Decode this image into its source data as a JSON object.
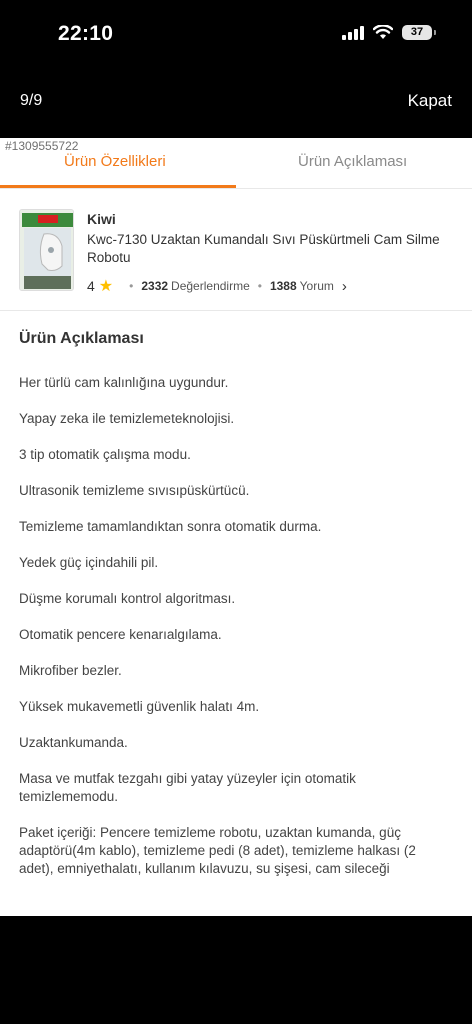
{
  "status_bar": {
    "time": "22:10",
    "battery": "37"
  },
  "viewer": {
    "page_counter": "9/9",
    "close_label": "Kapat"
  },
  "watermark_id": "#1309555722",
  "tabs": [
    {
      "label": "Ürün Özellikleri",
      "active": true
    },
    {
      "label": "Ürün Açıklaması",
      "active": false
    }
  ],
  "product": {
    "brand": "Kiwi",
    "name": "Kwc-7130 Uzaktan Kumandalı Sıvı Püskürtmeli Cam Silme Robotu",
    "rating": "4",
    "rating_count": "2332",
    "rating_label": "Değerlendirme",
    "review_count": "1388",
    "review_label": "Yorum"
  },
  "description": {
    "title": "Ürün Açıklaması",
    "items": [
      "Her türlü cam kalınlığına uygundur.",
      "Yapay zeka ile temizlemeteknolojisi.",
      "3 tip otomatik çalışma modu.",
      "Ultrasonik temizleme sıvısıpüskürtücü.",
      "Temizleme tamamlandıktan sonra otomatik durma.",
      "Yedek güç içindahili pil.",
      "Düşme korumalı kontrol algoritması.",
      "Otomatik pencere kenarıalgılama.",
      "Mikrofiber bezler.",
      "Yüksek mukavemetli güvenlik halatı 4m.",
      "Uzaktankumanda.",
      "Masa ve mutfak tezgahı gibi yatay yüzeyler için otomatik temizlememodu.",
      "Paket içeriği: Pencere temizleme robotu, uzaktan kumanda, güç adaptörü(4m kablo), temizleme pedi (8 adet), temizleme halkası (2 adet), emniyethalatı, kullanım kılavuzu, su şişesi, cam sileceği"
    ]
  },
  "colors": {
    "accent": "#f27a1a",
    "star": "#ffc000"
  }
}
